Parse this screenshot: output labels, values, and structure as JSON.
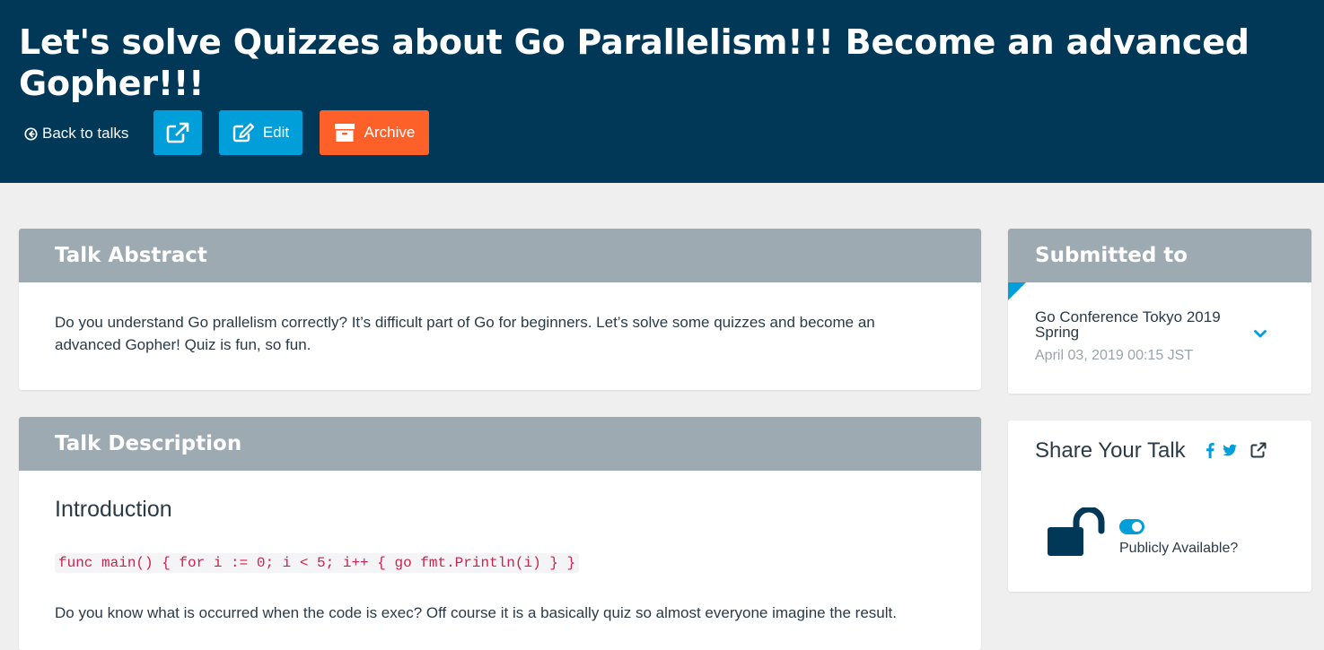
{
  "header": {
    "title": "Let's solve Quizzes about Go Parallelism!!! Become an advanced Gopher!!!",
    "back_label": "Back to talks",
    "edit_label": "Edit",
    "archive_label": "Archive"
  },
  "abstract": {
    "heading": "Talk Abstract",
    "text": "Do you understand Go prallelism correctly? It’s difficult part of Go for beginners. Let’s solve some quizzes and become an advanced Gopher! Quiz is fun, so fun."
  },
  "description": {
    "heading": "Talk Description",
    "subheading": "Introduction",
    "code": "func main() { for i := 0; i < 5; i++ { go fmt.Println(i) } }",
    "paragraph": "Do you know what is occurred when the code is exec? Off course it is a basically quiz so almost everyone imagine the result."
  },
  "submitted": {
    "heading": "Submitted to",
    "conference": "Go Conference Tokyo 2019 Spring",
    "date": "April 03, 2019 00:15 JST"
  },
  "share": {
    "title": "Share Your Talk",
    "public_label": "Publicly Available?",
    "public_on": true
  },
  "colors": {
    "header_bg": "#013757",
    "primary": "#009fd9",
    "archive": "#fd6129",
    "card_head": "#9eaab2"
  },
  "icons": {
    "back": "circle-arrow-left-icon",
    "open": "external-link-icon",
    "edit": "edit-icon",
    "archive": "archive-icon",
    "chevron": "chevron-down-icon",
    "facebook": "facebook-icon",
    "twitter": "twitter-icon",
    "share_external": "external-link-icon",
    "lock": "unlock-icon"
  }
}
